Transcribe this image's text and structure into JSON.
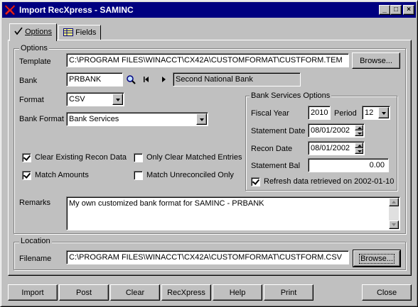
{
  "window": {
    "title": "Import RecXpress - SAMINC",
    "minimize_label": "_",
    "maximize_label": "□",
    "close_label": "×"
  },
  "tabs": [
    {
      "label": "Options",
      "active": true
    },
    {
      "label": "Fields",
      "active": false
    }
  ],
  "options_group": {
    "title": "Options",
    "template_label": "Template",
    "template_value": "C:\\PROGRAM FILES\\WINACCT\\CX42A\\CUSTOMFORMAT\\CUSTFORM.TEM",
    "browse_label": "Browse...",
    "bank_label": "Bank",
    "bank_value": "PRBANK",
    "bank_name": "Second National Bank",
    "format_label": "Format",
    "format_value": "CSV",
    "bank_format_label": "Bank Format",
    "bank_format_value": "Bank Services",
    "clear_existing_label": "Clear Existing Recon Data",
    "clear_existing_checked": true,
    "match_amounts_label": "Match Amounts",
    "match_amounts_checked": true,
    "only_clear_label": "Only Clear Matched Entries",
    "only_clear_checked": false,
    "match_unreconciled_label": "Match Unreconciled Only",
    "match_unreconciled_checked": false,
    "remarks_label": "Remarks",
    "remarks_value": "My own customized bank format for SAMINC - PRBANK"
  },
  "bank_services": {
    "title": "Bank Services Options",
    "fiscal_year_label": "Fiscal Year",
    "fiscal_year_value": "2010",
    "period_label": "Period",
    "period_value": "12",
    "statement_date_label": "Statement Date",
    "statement_date_value": "08/01/2002",
    "recon_date_label": "Recon Date",
    "recon_date_value": "08/01/2002",
    "statement_bal_label": "Statement Bal",
    "statement_bal_value": "0.00",
    "refresh_label": "Refresh data",
    "refresh_checked": true,
    "retrieved_text": "retrieved on 2002-01-10"
  },
  "location_group": {
    "title": "Location",
    "filename_label": "Filename",
    "filename_value": "C:\\PROGRAM FILES\\WINACCT\\CX42A\\CUSTOMFORMAT\\CUSTFORM.CSV",
    "browse_label": "Browse..."
  },
  "buttons": {
    "import": "Import",
    "post": "Post",
    "clear": "Clear",
    "recxpress": "RecXpress",
    "help": "Help",
    "print": "Print",
    "close": "Close"
  },
  "colors": {
    "title_bar": "#000080",
    "face": "#c0c0c0",
    "readonly_field": "#c0c0c0",
    "input_field": "#ffffff"
  }
}
